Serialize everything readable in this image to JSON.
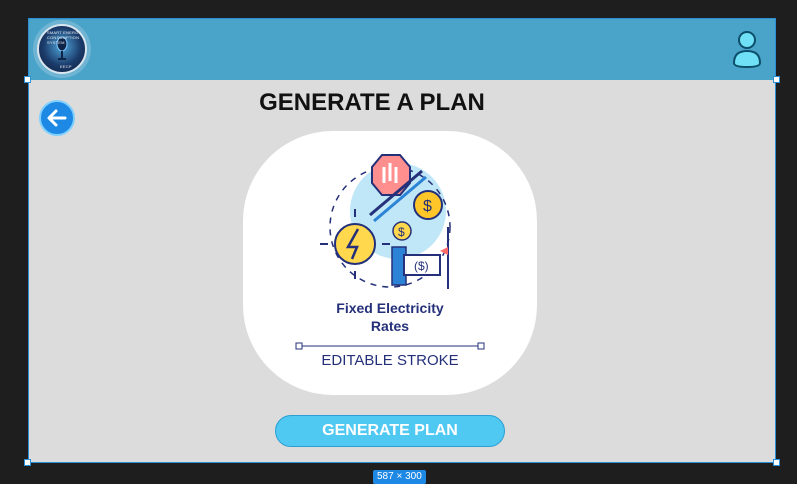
{
  "header": {
    "logo_text_top": "SMART ENERGY CONSUMPTION SYSTEM",
    "logo_text_bottom": "EECP"
  },
  "page": {
    "title": "GENERATE A PLAN"
  },
  "card": {
    "caption_line1": "Fixed Electricity",
    "caption_line2": "Rates",
    "footer": "EDITABLE STROKE"
  },
  "actions": {
    "generate_label": "GENERATE PLAN"
  },
  "canvas": {
    "size_label": "587 × 300"
  },
  "icons": {
    "back": "arrow-left-icon",
    "user": "user-icon",
    "illustration": "fixed-electricity-rates-icon"
  },
  "colors": {
    "header": "#4aa3c9",
    "content_bg": "#dcdcdc",
    "button": "#4fc8f2",
    "back_button": "#1e88e5",
    "caption": "#24307a"
  }
}
